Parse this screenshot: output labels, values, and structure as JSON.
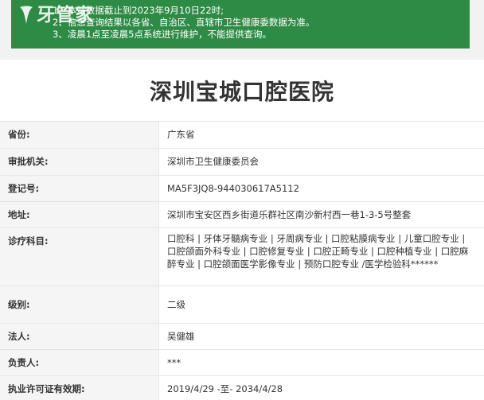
{
  "notice": {
    "logo": "牙管家",
    "lines": [
      "1、本站数据截止到2023年9月10日22时;",
      "2、信息查询结果以各省、自治区、直辖市卫生健康委数据为准。",
      "3、凌晨1点至凌晨5点系统进行维护，不能提供查询。"
    ]
  },
  "hospital_name": "深圳宝城口腔医院",
  "fields": [
    {
      "label": "省份:",
      "value": "广东省"
    },
    {
      "label": "审批机关:",
      "value": "深圳市卫生健康委员会"
    },
    {
      "label": "登记号:",
      "value": "MA5F3JQ8-944030617A5112"
    },
    {
      "label": "地址:",
      "value": "深圳市宝安区西乡街道乐群社区南沙新村西一巷1-3-5号整套"
    },
    {
      "label": "诊疗科目:",
      "value": "口腔科 | 牙体牙髓病专业 | 牙周病专业 | 口腔粘膜病专业 | 儿童口腔专业 | 口腔颌面外科专业 | 口腔修复专业 | 口腔正畸专业 | 口腔种植专业 | 口腔麻醉专业 | 口腔颌面医学影像专业 | 预防口腔专业 /医学检验科******"
    },
    {
      "label": "级别:",
      "value": "二级"
    },
    {
      "label": "法人:",
      "value": "吴健雄"
    },
    {
      "label": "负责人:",
      "value": "***"
    },
    {
      "label": "执业许可证有效期:",
      "value": "2019/4/29 -至- 2034/4/28"
    }
  ]
}
